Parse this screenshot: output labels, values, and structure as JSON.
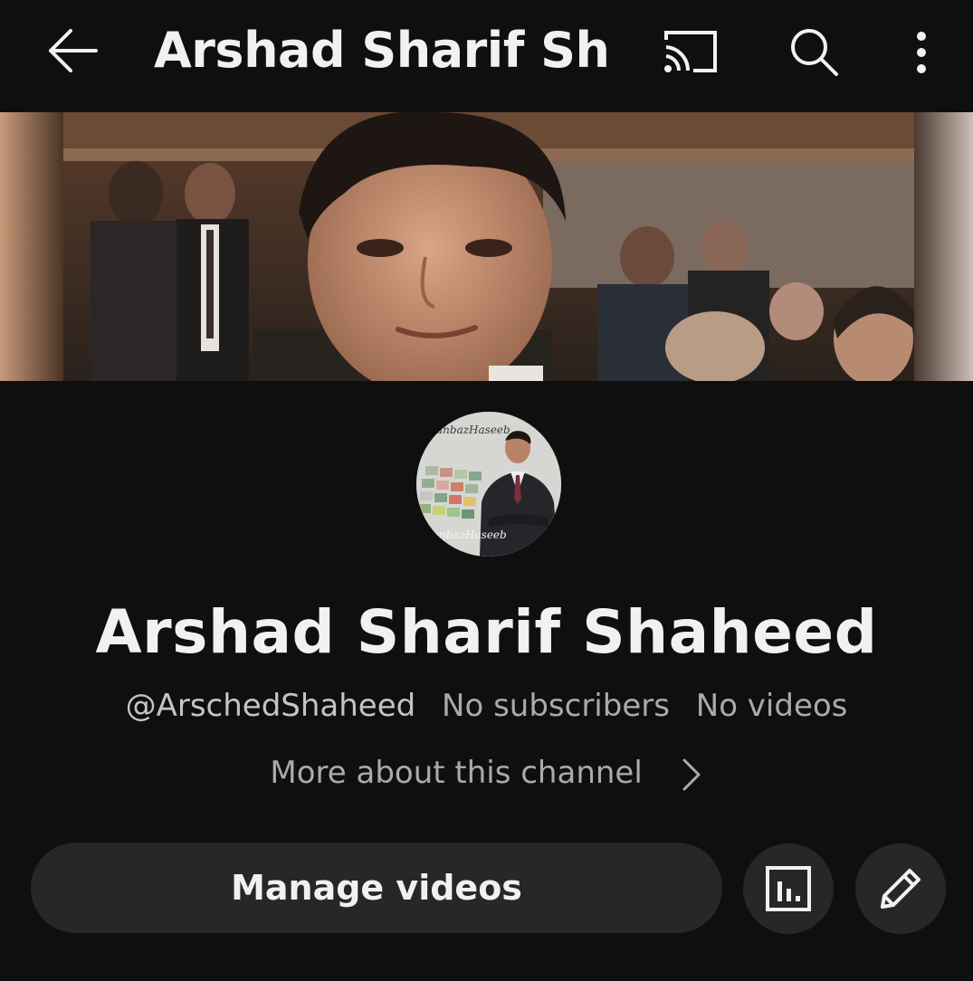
{
  "topbar": {
    "title": "Arshad Sharif Sha…",
    "icons": [
      "back-arrow-icon",
      "cast-icon",
      "search-icon",
      "more-vert-icon"
    ]
  },
  "channel": {
    "name": "Arshad Sharif Shaheed",
    "handle": "@ArschedShaheed",
    "subscribers": "No subscribers",
    "videos": "No videos",
    "more_about": "More about this channel",
    "avatar_watermark_top": "anbazHaseeb",
    "avatar_watermark_bottom": "anbazHaseeb"
  },
  "actions": {
    "manage_videos": "Manage videos",
    "analytics_icon": "analytics-icon",
    "edit_icon": "pencil-icon"
  },
  "colors": {
    "background": "#0f0f0f",
    "button": "#272727",
    "text_primary": "#f1f1f1",
    "text_secondary": "#aaaaaa"
  }
}
